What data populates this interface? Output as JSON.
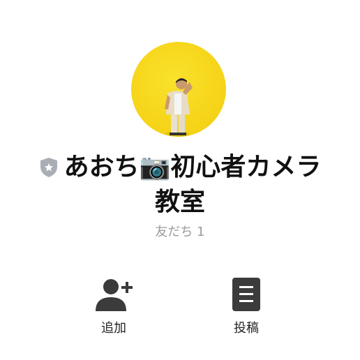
{
  "profile": {
    "name_line1": "あおち📷初心者カメラ",
    "name_line2": "教室",
    "friends_label": "友だち",
    "friends_count": "1",
    "avatar_bg_color": "#f6d51a",
    "badge_icon": "shield-star-icon"
  },
  "actions": {
    "add_label": "追加",
    "add_icon": "add-user-icon",
    "post_label": "投稿",
    "post_icon": "post-list-icon"
  }
}
